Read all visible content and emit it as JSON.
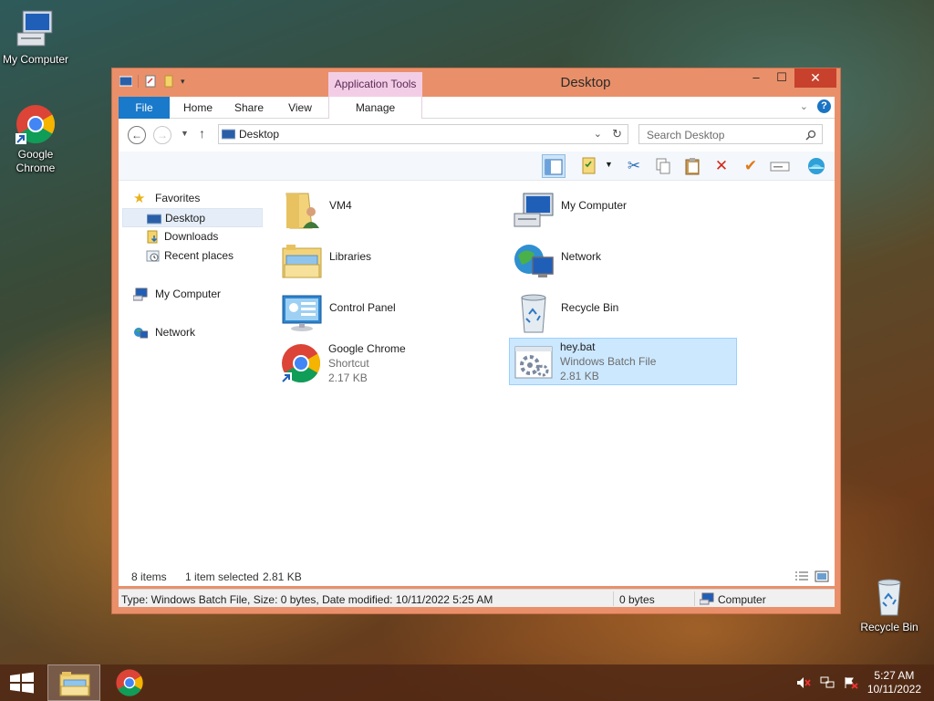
{
  "desktop": {
    "icons": [
      {
        "label": "My Computer",
        "icon": "computer-icon"
      },
      {
        "label": "Google Chrome",
        "icon": "chrome-icon"
      },
      {
        "label": "Recycle Bin",
        "icon": "recycle-bin-icon"
      }
    ]
  },
  "window": {
    "title": "Desktop",
    "context_tab_header": "Application Tools",
    "ribbon_tabs": [
      "File",
      "Home",
      "Share",
      "View",
      "Manage"
    ],
    "address": "Desktop",
    "search_placeholder": "Search Desktop",
    "controls": {
      "minimize": "–",
      "maximize": "☐",
      "close": "✕"
    }
  },
  "sidebar": {
    "favorites": "Favorites",
    "items": [
      "Desktop",
      "Downloads",
      "Recent places"
    ],
    "my_computer": "My Computer",
    "network": "Network"
  },
  "files": [
    {
      "name": "VM4",
      "sub1": "",
      "sub2": "",
      "icon": "user-folder-icon"
    },
    {
      "name": "My Computer",
      "sub1": "",
      "sub2": "",
      "icon": "computer-icon"
    },
    {
      "name": "Libraries",
      "sub1": "",
      "sub2": "",
      "icon": "libraries-icon"
    },
    {
      "name": "Network",
      "sub1": "",
      "sub2": "",
      "icon": "network-icon"
    },
    {
      "name": "Control Panel",
      "sub1": "",
      "sub2": "",
      "icon": "control-panel-icon"
    },
    {
      "name": "Recycle Bin",
      "sub1": "",
      "sub2": "",
      "icon": "recycle-bin-icon"
    },
    {
      "name": "Google Chrome",
      "sub1": "Shortcut",
      "sub2": "2.17 KB",
      "icon": "chrome-icon"
    },
    {
      "name": "hey.bat",
      "sub1": "Windows Batch File",
      "sub2": "2.81 KB",
      "icon": "batch-file-icon",
      "selected": true
    }
  ],
  "status": {
    "items_count": "8 items",
    "selection": "1 item selected",
    "selection_size": "2.81 KB",
    "details": "Type: Windows Batch File, Size: 0 bytes, Date modified: 10/11/2022 5:25 AM",
    "size": "0 bytes",
    "location": "Computer"
  },
  "taskbar": {
    "time": "5:27 AM",
    "date": "10/11/2022"
  },
  "colors": {
    "window_frame": "#e9906a",
    "file_tab": "#1979ca",
    "context_tab": "#f3cde6",
    "selection": "#cce8ff",
    "close_button": "#c7412c"
  }
}
